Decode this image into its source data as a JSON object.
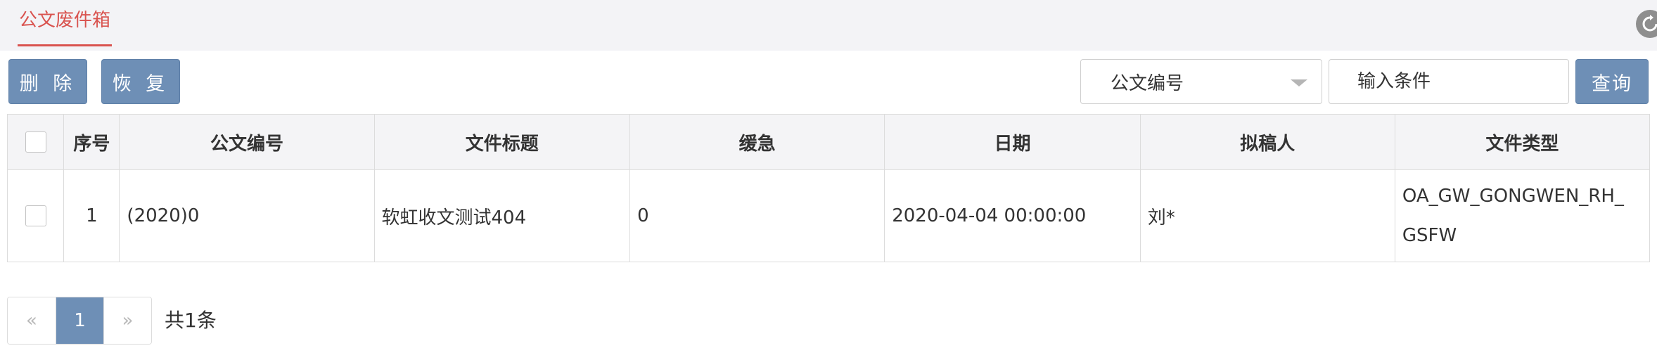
{
  "tab": {
    "label": "公文废件箱"
  },
  "toolbar": {
    "delete_label": "删 除",
    "restore_label": "恢 复",
    "query_label": "查询"
  },
  "search": {
    "field_selected": "公文编号",
    "placeholder": "输入条件",
    "value": ""
  },
  "table": {
    "headers": [
      "序号",
      "公文编号",
      "文件标题",
      "缓急",
      "日期",
      "拟稿人",
      "文件类型"
    ],
    "rows": [
      {
        "index": "1",
        "doc_number": "(2020)0",
        "title": "软虹收文测试404",
        "urgency": "0",
        "date": "2020-04-04 00:00:00",
        "drafter": "刘*",
        "type_line1": "OA_GW_GONGWEN_RH_",
        "type_line2": "GSFW"
      }
    ]
  },
  "pagination": {
    "prev": "«",
    "current": "1",
    "next": "»",
    "total_text": "共1条"
  },
  "colors": {
    "accent_tab": "#d9534f",
    "button": "#6e8fb6"
  },
  "icons": {
    "refresh": "refresh-icon"
  }
}
